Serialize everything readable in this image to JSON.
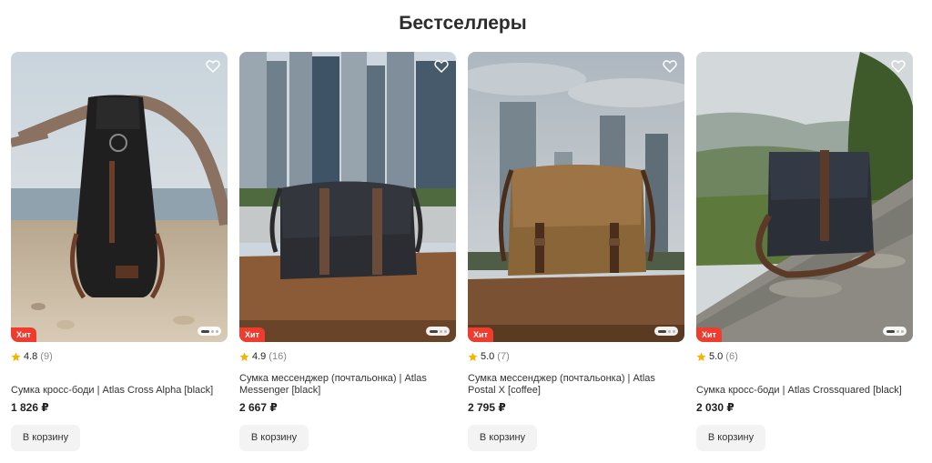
{
  "section": {
    "title": "Бестселлеры"
  },
  "colors": {
    "badge": "#f03c2e",
    "star": "#f5b400",
    "button_bg": "#f3f3f3"
  },
  "products": [
    {
      "name": "Сумка кросс-боди | Atlas Cross Alpha [black]",
      "rating": "4.8",
      "reviews": "(9)",
      "price": "1 826 ₽",
      "badge": "Хит",
      "cart_label": "В корзину",
      "image": "black-sling-bag-on-driftwood-by-sea",
      "favorite_icon": "heart-icon"
    },
    {
      "name": "Сумка мессенджер (почтальонка) | Atlas Messenger [black]",
      "rating": "4.9",
      "reviews": "(16)",
      "price": "2 667 ₽",
      "badge": "Хит",
      "cart_label": "В корзину",
      "image": "black-messenger-bag-on-table-city",
      "favorite_icon": "heart-icon"
    },
    {
      "name": "Сумка мессенджер (почтальонка) | Atlas Postal X [coffee]",
      "rating": "5.0",
      "reviews": "(7)",
      "price": "2 795 ₽",
      "badge": "Хит",
      "cart_label": "В корзину",
      "image": "brown-messenger-bag-on-table-skyline",
      "favorite_icon": "heart-icon"
    },
    {
      "name": "Сумка кросс-боди | Atlas Crossquared [black]",
      "rating": "5.0",
      "reviews": "(6)",
      "price": "2 030 ₽",
      "badge": "Хит",
      "cart_label": "В корзину",
      "image": "black-crossbody-bag-on-stone-wall",
      "favorite_icon": "heart-icon"
    }
  ]
}
